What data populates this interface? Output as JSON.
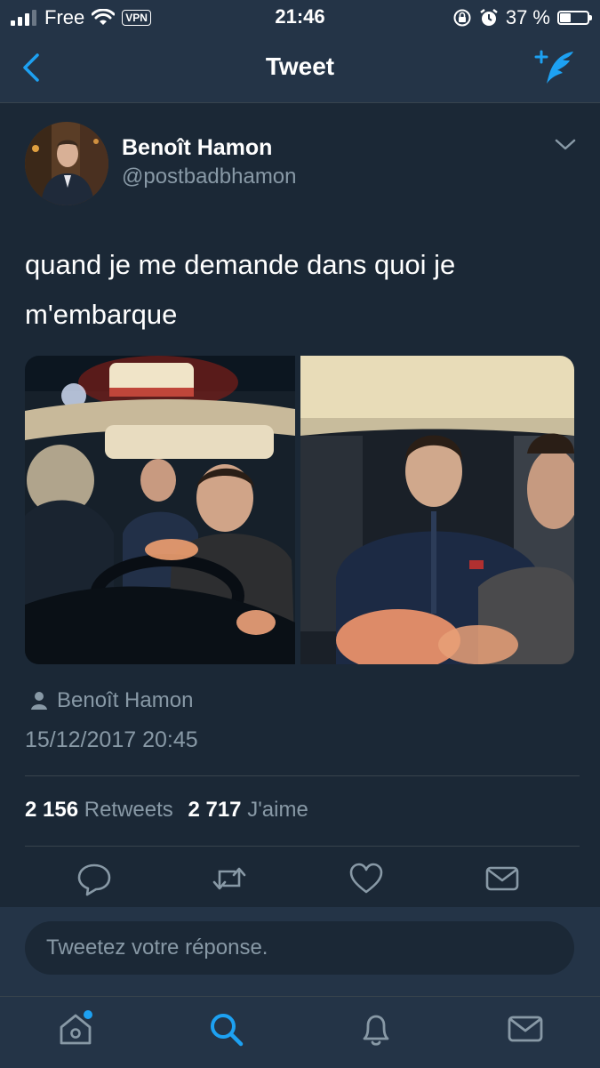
{
  "status_bar": {
    "carrier": "Free",
    "vpn": "VPN",
    "time": "21:46",
    "battery_text": "37 %",
    "battery_level": 0.37
  },
  "nav": {
    "title": "Tweet",
    "back_icon": "chevron-left-icon",
    "compose_icon": "compose-tweet-icon"
  },
  "tweet": {
    "author_name": "Benoît Hamon",
    "author_handle": "@postbadbhamon",
    "text_line1": "quand je me demande dans quoi je",
    "text_line2": "m'embarque",
    "source_name": "Benoît Hamon",
    "timestamp": "15/12/2017 20:45",
    "retweets_count": "2 156",
    "retweets_label": "Retweets",
    "likes_count": "2 717",
    "likes_label": "J'aime"
  },
  "reply": {
    "placeholder": "Tweetez votre réponse."
  },
  "colors": {
    "background": "#1b2836",
    "bar": "#243447",
    "accent": "#1da1f2",
    "secondary_text": "#8899a6",
    "divider": "#38444d"
  },
  "tabs": [
    "home-icon",
    "search-icon",
    "notifications-icon",
    "messages-icon"
  ]
}
